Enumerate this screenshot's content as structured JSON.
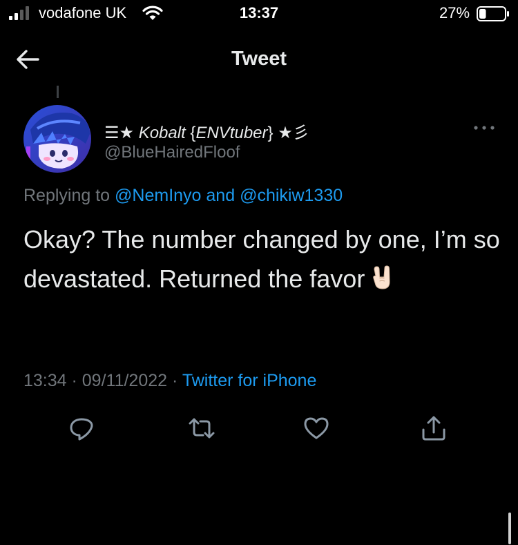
{
  "status_bar": {
    "carrier": "vodafone UK",
    "time": "13:37",
    "battery_percent": "27%",
    "battery_level": 0.27,
    "icons": [
      "signal-icon",
      "wifi-icon",
      "battery-icon"
    ]
  },
  "nav": {
    "title": "Tweet",
    "back_icon": "arrow-left-icon"
  },
  "tweet": {
    "author": {
      "name_prefix": "☰★ ",
      "name_italic": "Kobalt",
      "name_middle": " {",
      "name_tag": "ENVtuber",
      "name_suffix": "} ★彡",
      "handle": "@BlueHairedFloof"
    },
    "replying_label": "Replying to ",
    "reply_to_1": "@NemInyo",
    "reply_conj": " and ",
    "reply_to_2": "@chikiw1330",
    "text": "Okay? The number changed by one, I’m so devastated. Returned the favor",
    "emoji": "sign-of-the-horns-emoji",
    "time": "13:34",
    "separator": " · ",
    "date": "09/11/2022",
    "source": "Twitter for iPhone"
  },
  "actions": [
    "reply-icon",
    "retweet-icon",
    "like-icon",
    "share-icon"
  ],
  "colors": {
    "background": "#000000",
    "text": "#e7e9ea",
    "secondary": "#71767b",
    "accent": "#1d9bf0"
  }
}
